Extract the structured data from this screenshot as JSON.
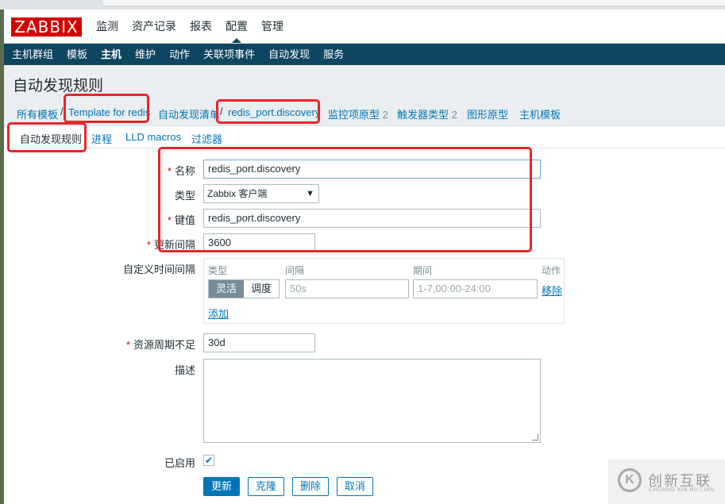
{
  "header": {
    "logo": "ZABBIX",
    "menu": [
      "监测",
      "资产记录",
      "报表",
      "配置",
      "管理"
    ],
    "selected_menu": "配置"
  },
  "subnav": {
    "items": [
      "主机群组",
      "模板",
      "主机",
      "维护",
      "动作",
      "关联项事件",
      "自动发现",
      "服务"
    ],
    "selected": "主机"
  },
  "page_title": "自动发现规则",
  "breadcrumbs": {
    "all_templates": "所有模板",
    "template": "Template for redis",
    "discovery_list": "自动发现清单",
    "rule": "redis_port.discovery",
    "item_prototypes": "监控项原型",
    "item_prototypes_count": "2",
    "trigger_prototypes": "触发器类型",
    "trigger_prototypes_count": "2",
    "graph_prototypes": "图形原型",
    "host_prototypes": "主机模板"
  },
  "tabs": [
    "自动发现规则",
    "进程",
    "LLD macros",
    "过滤器"
  ],
  "form": {
    "name_label": "名称",
    "name_value": "redis_port.discovery",
    "type_label": "类型",
    "type_value": "Zabbix 客户端",
    "key_label": "键值",
    "key_value": "redis_port.discovery",
    "interval_label": "更新间隔",
    "interval_value": "3600",
    "custom_intervals_label": "自定义时间间隔",
    "custom_intervals": {
      "headers": [
        "类型",
        "间隔",
        "期间",
        "动作"
      ],
      "type_options": [
        "灵活",
        "调度"
      ],
      "type_selected": "灵活",
      "interval_placeholder": "50s",
      "period_placeholder": "1-7,00:00-24:00",
      "remove_label": "移除",
      "add_label": "添加"
    },
    "lifetime_label": "资源周期不足",
    "lifetime_value": "30d",
    "description_label": "描述",
    "description_value": "",
    "enabled_label": "已启用",
    "enabled": true
  },
  "buttons": {
    "update": "更新",
    "clone": "克隆",
    "delete": "删除",
    "cancel": "取消"
  },
  "watermark": {
    "logo_text": "创新互联",
    "sub_text": "CHUANG XIN HU LIAN",
    "icon_glyph": "K"
  },
  "colors": {
    "brand_red": "#d40000",
    "nav_blue": "#0e4561",
    "link_blue": "#0275b8",
    "highlight_red": "#e8262a"
  }
}
